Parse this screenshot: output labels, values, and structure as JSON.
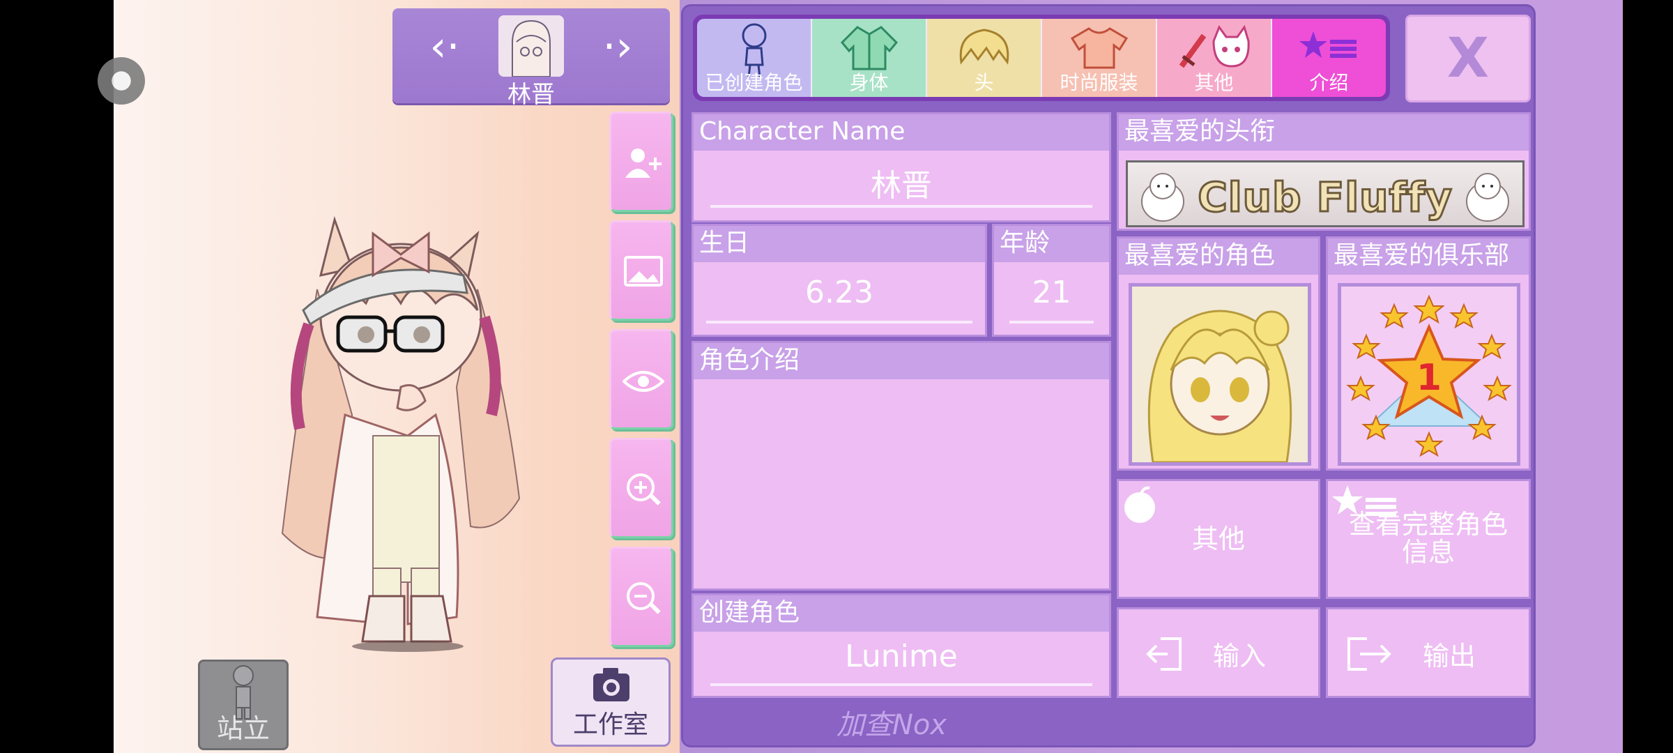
{
  "character_selector": {
    "name": "林晋",
    "prev_arrow": "‹·",
    "next_arrow": "·›"
  },
  "side_toolbar": {
    "icons": [
      "add-user-icon",
      "image-icon",
      "eye-icon",
      "zoom-in-icon",
      "zoom-out-icon"
    ]
  },
  "bottom_buttons": {
    "stand_label": "站立",
    "studio_label": "工作室"
  },
  "tabs": [
    {
      "id": "created",
      "label": "已创建角色",
      "icon": "character-outline-icon"
    },
    {
      "id": "body",
      "label": "身体",
      "icon": "jacket-icon"
    },
    {
      "id": "head",
      "label": "头",
      "icon": "hair-icon"
    },
    {
      "id": "fashion",
      "label": "时尚服装",
      "icon": "shirt-icon"
    },
    {
      "id": "other",
      "label": "其他",
      "icon": "sword-cat-icon"
    },
    {
      "id": "intro",
      "label": "介绍",
      "icon": "star-list-icon",
      "active": true
    }
  ],
  "close_label": "X",
  "profile": {
    "name_header": "Character Name",
    "name_value": "林晋",
    "birthday_header": "生日",
    "birthday_value": "6.23",
    "age_header": "年龄",
    "age_value": "21",
    "intro_header": "角色介绍",
    "intro_value": "",
    "creator_header": "创建角色",
    "creator_value": "Lunime"
  },
  "favorites": {
    "title_header": "最喜爱的头衔",
    "title_value": "Club Fluffy",
    "character_header": "最喜爱的角色",
    "club_header": "最喜爱的俱乐部",
    "club_badge_number": "1"
  },
  "actions": {
    "other_label": "其他",
    "full_info_label_line1": "查看完整角色",
    "full_info_label_line2": "信息",
    "import_label": "输入",
    "export_label": "输出"
  },
  "watermark": "加查Nox",
  "colors": {
    "panel_purple": "#8a63c4",
    "section_pink": "#eebdf3",
    "section_header": "#c8a1e8",
    "active_tab": "#ee4fd6"
  }
}
